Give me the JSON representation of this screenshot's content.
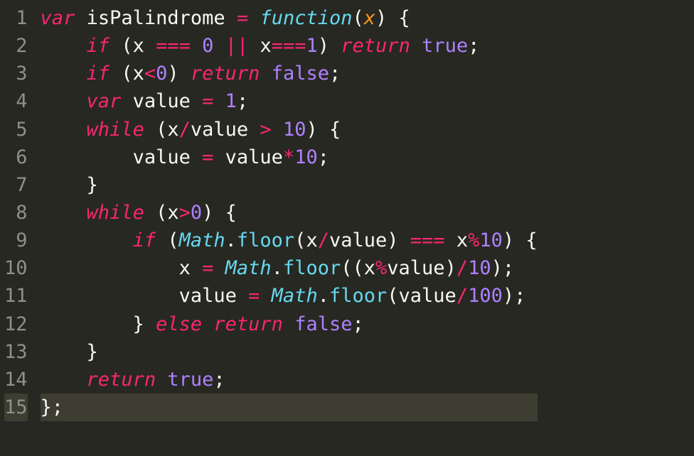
{
  "lines": [
    {
      "n": "1",
      "tokens": [
        {
          "c": "kw",
          "t": "var"
        },
        {
          "c": "pn",
          "t": " "
        },
        {
          "c": "id",
          "t": "isPalindrome"
        },
        {
          "c": "pn",
          "t": " "
        },
        {
          "c": "op",
          "t": "="
        },
        {
          "c": "pn",
          "t": " "
        },
        {
          "c": "cls",
          "t": "function"
        },
        {
          "c": "pn",
          "t": "("
        },
        {
          "c": "param",
          "t": "x"
        },
        {
          "c": "pn",
          "t": ") {"
        }
      ]
    },
    {
      "n": "2",
      "tokens": [
        {
          "c": "pn",
          "t": "    "
        },
        {
          "c": "kw",
          "t": "if"
        },
        {
          "c": "pn",
          "t": " ("
        },
        {
          "c": "id",
          "t": "x"
        },
        {
          "c": "pn",
          "t": " "
        },
        {
          "c": "op",
          "t": "==="
        },
        {
          "c": "pn",
          "t": " "
        },
        {
          "c": "num",
          "t": "0"
        },
        {
          "c": "pn",
          "t": " "
        },
        {
          "c": "op",
          "t": "||"
        },
        {
          "c": "pn",
          "t": " "
        },
        {
          "c": "id",
          "t": "x"
        },
        {
          "c": "op",
          "t": "==="
        },
        {
          "c": "num",
          "t": "1"
        },
        {
          "c": "pn",
          "t": ") "
        },
        {
          "c": "kw",
          "t": "return"
        },
        {
          "c": "pn",
          "t": " "
        },
        {
          "c": "bool",
          "t": "true"
        },
        {
          "c": "pn",
          "t": ";"
        }
      ]
    },
    {
      "n": "3",
      "tokens": [
        {
          "c": "pn",
          "t": "    "
        },
        {
          "c": "kw",
          "t": "if"
        },
        {
          "c": "pn",
          "t": " ("
        },
        {
          "c": "id",
          "t": "x"
        },
        {
          "c": "op",
          "t": "<"
        },
        {
          "c": "num",
          "t": "0"
        },
        {
          "c": "pn",
          "t": ") "
        },
        {
          "c": "kw",
          "t": "return"
        },
        {
          "c": "pn",
          "t": " "
        },
        {
          "c": "bool",
          "t": "false"
        },
        {
          "c": "pn",
          "t": ";"
        }
      ]
    },
    {
      "n": "4",
      "tokens": [
        {
          "c": "pn",
          "t": "    "
        },
        {
          "c": "kw",
          "t": "var"
        },
        {
          "c": "pn",
          "t": " "
        },
        {
          "c": "id",
          "t": "value"
        },
        {
          "c": "pn",
          "t": " "
        },
        {
          "c": "op",
          "t": "="
        },
        {
          "c": "pn",
          "t": " "
        },
        {
          "c": "num",
          "t": "1"
        },
        {
          "c": "pn",
          "t": ";"
        }
      ]
    },
    {
      "n": "5",
      "tokens": [
        {
          "c": "pn",
          "t": "    "
        },
        {
          "c": "kw",
          "t": "while"
        },
        {
          "c": "pn",
          "t": " ("
        },
        {
          "c": "id",
          "t": "x"
        },
        {
          "c": "op",
          "t": "/"
        },
        {
          "c": "id",
          "t": "value"
        },
        {
          "c": "pn",
          "t": " "
        },
        {
          "c": "op",
          "t": ">"
        },
        {
          "c": "pn",
          "t": " "
        },
        {
          "c": "num",
          "t": "10"
        },
        {
          "c": "pn",
          "t": ") {"
        }
      ]
    },
    {
      "n": "6",
      "tokens": [
        {
          "c": "pn",
          "t": "        "
        },
        {
          "c": "id",
          "t": "value"
        },
        {
          "c": "pn",
          "t": " "
        },
        {
          "c": "op",
          "t": "="
        },
        {
          "c": "pn",
          "t": " "
        },
        {
          "c": "id",
          "t": "value"
        },
        {
          "c": "op",
          "t": "*"
        },
        {
          "c": "num",
          "t": "10"
        },
        {
          "c": "pn",
          "t": ";"
        }
      ]
    },
    {
      "n": "7",
      "tokens": [
        {
          "c": "pn",
          "t": "    }"
        }
      ]
    },
    {
      "n": "8",
      "tokens": [
        {
          "c": "pn",
          "t": "    "
        },
        {
          "c": "kw",
          "t": "while"
        },
        {
          "c": "pn",
          "t": " ("
        },
        {
          "c": "id",
          "t": "x"
        },
        {
          "c": "op",
          "t": ">"
        },
        {
          "c": "num",
          "t": "0"
        },
        {
          "c": "pn",
          "t": ") {"
        }
      ]
    },
    {
      "n": "9",
      "tokens": [
        {
          "c": "pn",
          "t": "        "
        },
        {
          "c": "kw",
          "t": "if"
        },
        {
          "c": "pn",
          "t": " ("
        },
        {
          "c": "cls",
          "t": "Math"
        },
        {
          "c": "pn",
          "t": "."
        },
        {
          "c": "call",
          "t": "floor"
        },
        {
          "c": "pn",
          "t": "("
        },
        {
          "c": "id",
          "t": "x"
        },
        {
          "c": "op",
          "t": "/"
        },
        {
          "c": "id",
          "t": "value"
        },
        {
          "c": "pn",
          "t": ") "
        },
        {
          "c": "op",
          "t": "==="
        },
        {
          "c": "pn",
          "t": " "
        },
        {
          "c": "id",
          "t": "x"
        },
        {
          "c": "op",
          "t": "%"
        },
        {
          "c": "num",
          "t": "10"
        },
        {
          "c": "pn",
          "t": ") {"
        }
      ]
    },
    {
      "n": "10",
      "tokens": [
        {
          "c": "pn",
          "t": "            "
        },
        {
          "c": "id",
          "t": "x"
        },
        {
          "c": "pn",
          "t": " "
        },
        {
          "c": "op",
          "t": "="
        },
        {
          "c": "pn",
          "t": " "
        },
        {
          "c": "cls",
          "t": "Math"
        },
        {
          "c": "pn",
          "t": "."
        },
        {
          "c": "call",
          "t": "floor"
        },
        {
          "c": "pn",
          "t": "(("
        },
        {
          "c": "id",
          "t": "x"
        },
        {
          "c": "op",
          "t": "%"
        },
        {
          "c": "id",
          "t": "value"
        },
        {
          "c": "pn",
          "t": ")"
        },
        {
          "c": "op",
          "t": "/"
        },
        {
          "c": "num",
          "t": "10"
        },
        {
          "c": "pn",
          "t": ");"
        }
      ]
    },
    {
      "n": "11",
      "tokens": [
        {
          "c": "pn",
          "t": "            "
        },
        {
          "c": "id",
          "t": "value"
        },
        {
          "c": "pn",
          "t": " "
        },
        {
          "c": "op",
          "t": "="
        },
        {
          "c": "pn",
          "t": " "
        },
        {
          "c": "cls",
          "t": "Math"
        },
        {
          "c": "pn",
          "t": "."
        },
        {
          "c": "call",
          "t": "floor"
        },
        {
          "c": "pn",
          "t": "("
        },
        {
          "c": "id",
          "t": "value"
        },
        {
          "c": "op",
          "t": "/"
        },
        {
          "c": "num",
          "t": "100"
        },
        {
          "c": "pn",
          "t": ");"
        }
      ]
    },
    {
      "n": "12",
      "tokens": [
        {
          "c": "pn",
          "t": "        } "
        },
        {
          "c": "kw",
          "t": "else"
        },
        {
          "c": "pn",
          "t": " "
        },
        {
          "c": "kw",
          "t": "return"
        },
        {
          "c": "pn",
          "t": " "
        },
        {
          "c": "bool",
          "t": "false"
        },
        {
          "c": "pn",
          "t": ";"
        }
      ]
    },
    {
      "n": "13",
      "tokens": [
        {
          "c": "pn",
          "t": "    }"
        }
      ]
    },
    {
      "n": "14",
      "tokens": [
        {
          "c": "pn",
          "t": "    "
        },
        {
          "c": "kw",
          "t": "return"
        },
        {
          "c": "pn",
          "t": " "
        },
        {
          "c": "bool",
          "t": "true"
        },
        {
          "c": "pn",
          "t": ";"
        }
      ]
    },
    {
      "n": "15",
      "active": true,
      "tokens": [
        {
          "c": "pn",
          "t": "};"
        }
      ]
    }
  ]
}
